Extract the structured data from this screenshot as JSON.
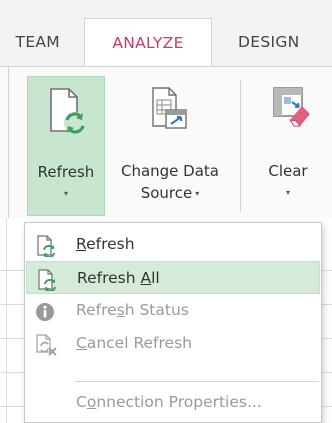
{
  "tabs": [
    {
      "id": "team",
      "label": "TEAM"
    },
    {
      "id": "analyze",
      "label": "ANALYZE",
      "active": true
    },
    {
      "id": "design",
      "label": "DESIGN"
    }
  ],
  "ribbon": {
    "refresh": {
      "label": "Refresh",
      "arrow": "▾",
      "icon": "refresh-document-icon"
    },
    "change_data_source": {
      "line1": "Change Data",
      "line2": "Source",
      "caret": "▾",
      "icon": "data-source-icon"
    },
    "clear": {
      "label": "Clear",
      "arrow": "▾",
      "icon": "clear-pivot-icon"
    }
  },
  "menu": {
    "items": [
      {
        "pre": "",
        "ul": "R",
        "post": "efresh",
        "enabled": true,
        "icon": "refresh-icon"
      },
      {
        "pre": "Refresh ",
        "ul": "A",
        "post": "ll",
        "enabled": true,
        "highlighted": true,
        "icon": "refresh-all-icon"
      },
      {
        "pre": "Refre",
        "ul": "s",
        "post": "h Status",
        "enabled": false,
        "icon": "info-icon"
      },
      {
        "pre": "",
        "ul": "C",
        "post": "ancel Refresh",
        "enabled": false,
        "icon": "cancel-refresh-icon"
      },
      {
        "pre": "C",
        "ul": "o",
        "post": "nnection Properties...",
        "enabled": false,
        "icon": ""
      }
    ]
  },
  "colors": {
    "accent": "#c73a6e",
    "refresh_green": "#3aa05a",
    "highlight": "#d5ebda",
    "ribbon_button_active": "#c7e5cf"
  }
}
